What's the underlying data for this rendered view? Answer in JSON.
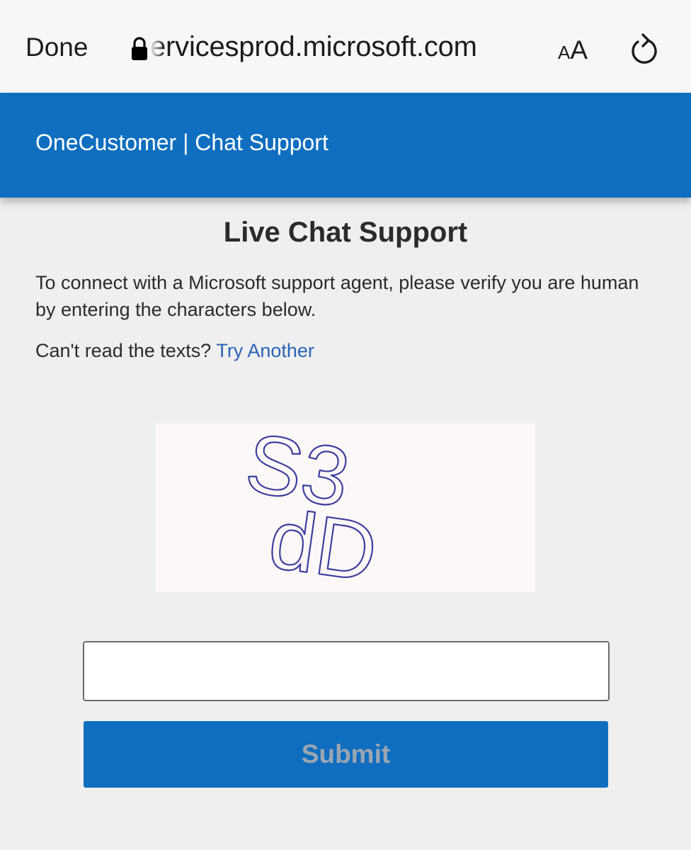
{
  "browser": {
    "done_label": "Done",
    "url_text": "ervicesprod.microsoft.com",
    "aa_small": "A",
    "aa_large": "A",
    "icons": [
      "lock-icon",
      "reload-icon"
    ]
  },
  "header": {
    "title": "OneCustomer | Chat Support",
    "background_color": "#0f6ebf"
  },
  "main": {
    "title": "Live Chat Support",
    "intro": "To connect with a Microsoft support agent, please verify you are human by entering the characters below.",
    "retry_prompt": "Can't read the texts?",
    "retry_link": "Try Another",
    "captcha": {
      "line1": "S3",
      "line2": "dD"
    },
    "input": {
      "value": "",
      "placeholder": ""
    },
    "submit_label": "Submit"
  }
}
